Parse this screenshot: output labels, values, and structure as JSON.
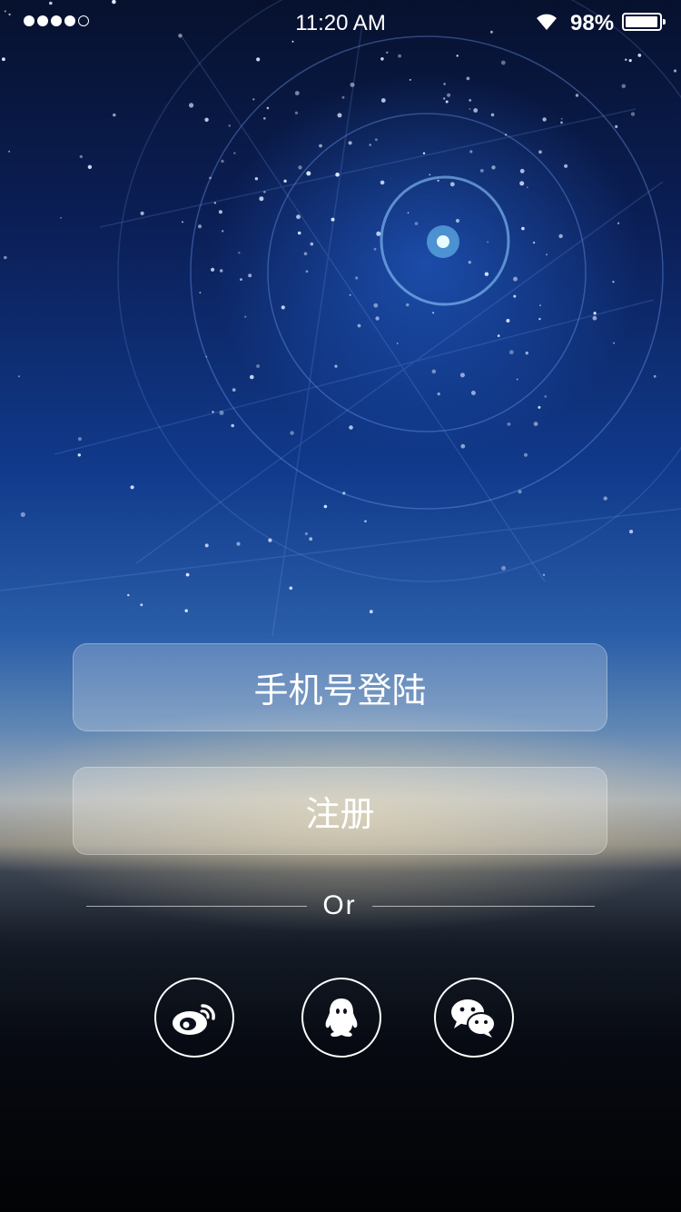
{
  "status_bar": {
    "time": "11:20 AM",
    "battery_percent_text": "98%",
    "battery_level": 0.98,
    "signal_bars_filled": 4,
    "signal_bars_total": 5
  },
  "actions": {
    "phone_login_label": "手机号登陆",
    "register_label": "注册"
  },
  "divider": {
    "text": "Or"
  },
  "social_logins": [
    {
      "icon": "weibo-icon"
    },
    {
      "icon": "qq-icon"
    },
    {
      "icon": "wechat-icon"
    }
  ]
}
